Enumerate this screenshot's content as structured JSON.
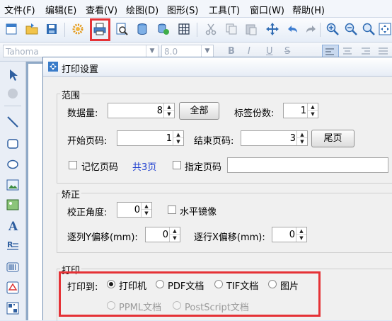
{
  "menu": [
    "文件(F)",
    "编辑(E)",
    "查看(V)",
    "绘图(D)",
    "图形(S)",
    "工具(T)",
    "窗口(W)",
    "帮助(H)"
  ],
  "font_toolbar": {
    "font_name": "Tahoma",
    "font_size": "8.0",
    "bold": "B",
    "italic": "I",
    "underline": "U",
    "strike": "S"
  },
  "dialog": {
    "title": "打印设置",
    "range": {
      "group_label": "范围",
      "data_count_label": "数据量:",
      "data_count_value": "8",
      "all_button": "全部",
      "label_copies_label": "标签份数:",
      "label_copies_value": "1",
      "start_page_label": "开始页码:",
      "start_page_value": "1",
      "end_page_label": "结束页码:",
      "end_page_value": "3",
      "last_page_button": "尾页",
      "remember_page_label": "记忆页码",
      "total_pages_text": "共3页",
      "specify_page_label": "指定页码"
    },
    "correction": {
      "group_label": "矫正",
      "angle_label": "校正角度:",
      "angle_value": "0",
      "mirror_label": "水平镜像",
      "y_offset_label": "逐列Y偏移(mm):",
      "y_offset_value": "0",
      "x_offset_label": "逐行X偏移(mm):",
      "x_offset_value": "0"
    },
    "print": {
      "group_label": "打印",
      "print_to_label": "打印到:",
      "options": [
        "打印机",
        "PDF文档",
        "TIF文档",
        "图片"
      ],
      "selected": "打印机",
      "disabled_options": [
        "PPML文档",
        "PostScript文档"
      ]
    }
  },
  "colors": {
    "highlight": "#e53236",
    "total_pages_text": "#1f3fd0",
    "canvas": "#8fa9c7"
  }
}
